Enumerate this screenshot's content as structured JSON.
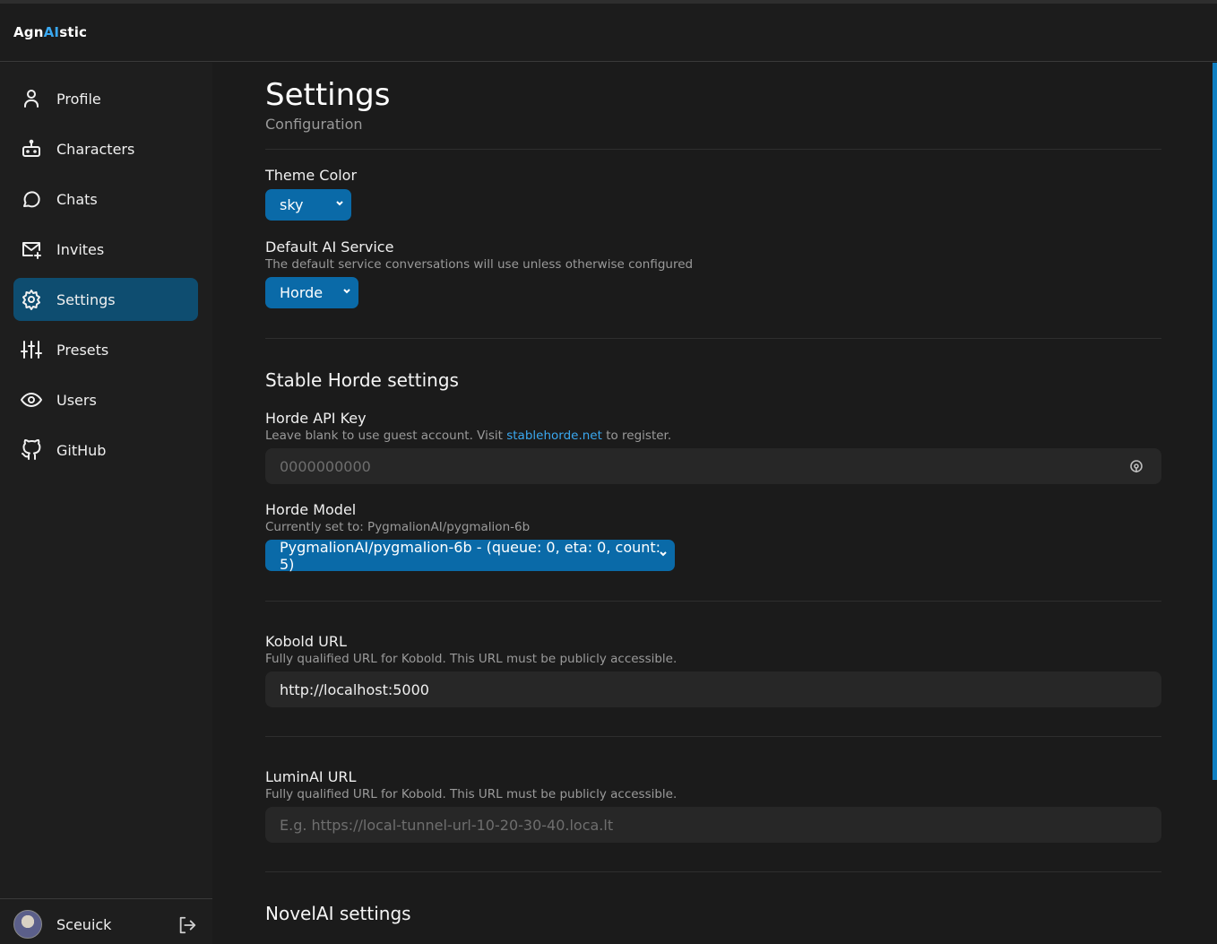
{
  "app": {
    "brand_left": "Agn",
    "brand_ai": "AI",
    "brand_right": "stic"
  },
  "sidebar": {
    "items": [
      {
        "label": "Profile",
        "icon": "user-icon"
      },
      {
        "label": "Characters",
        "icon": "bot-icon"
      },
      {
        "label": "Chats",
        "icon": "chat-bubble-icon"
      },
      {
        "label": "Invites",
        "icon": "mail-plus-icon"
      },
      {
        "label": "Settings",
        "icon": "gear-icon",
        "active": true
      },
      {
        "label": "Presets",
        "icon": "sliders-icon"
      },
      {
        "label": "Users",
        "icon": "eye-icon"
      },
      {
        "label": "GitHub",
        "icon": "github-icon"
      }
    ],
    "user": {
      "name": "Sceuick"
    }
  },
  "page": {
    "title": "Settings",
    "subtitle": "Configuration"
  },
  "theme": {
    "label": "Theme Color",
    "selected": "sky"
  },
  "default_service": {
    "label": "Default AI Service",
    "help": "The default service conversations will use unless otherwise configured",
    "selected": "Horde"
  },
  "horde": {
    "section_title": "Stable Horde settings",
    "api_key_label": "Horde API Key",
    "api_key_help_pre": "Leave blank to use guest account. Visit",
    "api_key_help_link": "stablehorde.net",
    "api_key_help_post": "to register.",
    "api_key_placeholder": "0000000000",
    "model_label": "Horde Model",
    "model_help": "Currently set to: PygmalionAI/pygmalion-6b",
    "model_selected": "PygmalionAI/pygmalion-6b - (queue: 0, eta: 0, count: 5)"
  },
  "kobold": {
    "label": "Kobold URL",
    "help": "Fully qualified URL for Kobold. This URL must be publicly accessible.",
    "value": "http://localhost:5000"
  },
  "luminai": {
    "label": "LuminAI URL",
    "help": "Fully qualified URL for Kobold. This URL must be publicly accessible.",
    "placeholder": "E.g. https://local-tunnel-url-10-20-30-40.loca.lt"
  },
  "novelai": {
    "section_title": "NovelAI settings"
  },
  "colors": {
    "accent": "#0a6aa8",
    "active_nav": "#0e4d70",
    "link": "#3aa8f0",
    "background": "#1b1b1b"
  }
}
